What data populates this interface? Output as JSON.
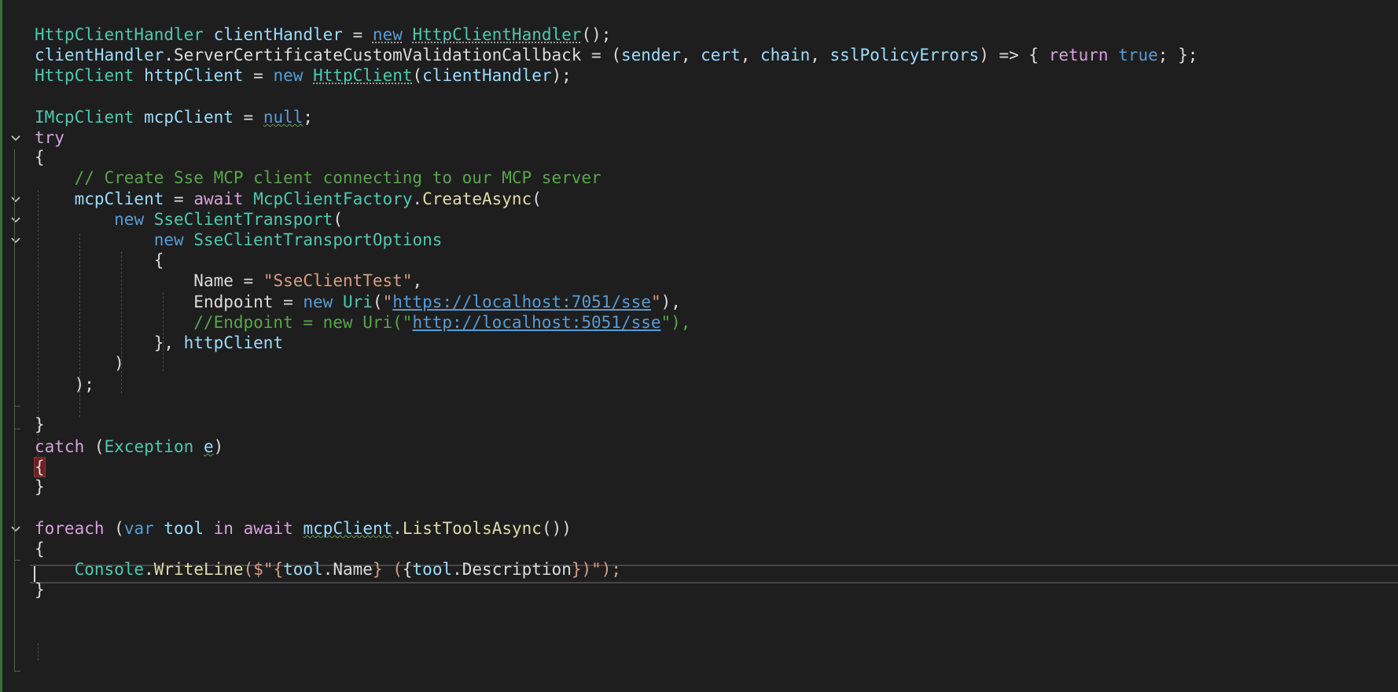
{
  "editor": {
    "lines": [
      {
        "tokens": [
          {
            "text": "HttpClientHandler",
            "c": "t"
          },
          {
            "text": " ",
            "c": "p"
          },
          {
            "text": "clientHandler",
            "c": "v"
          },
          {
            "text": " = ",
            "c": "p"
          },
          {
            "text": "new",
            "c": "k",
            "d": "dot"
          },
          {
            "text": " ",
            "c": "p"
          },
          {
            "text": "HttpClientHandler",
            "c": "t",
            "d": "dot"
          },
          {
            "text": "();",
            "c": "p"
          }
        ]
      },
      {
        "tokens": [
          {
            "text": "clientHandler",
            "c": "v"
          },
          {
            "text": ".",
            "c": "p"
          },
          {
            "text": "ServerCertificateCustomValidationCallback",
            "c": "p"
          },
          {
            "text": " = (",
            "c": "p"
          },
          {
            "text": "sender",
            "c": "v"
          },
          {
            "text": ", ",
            "c": "p"
          },
          {
            "text": "cert",
            "c": "v"
          },
          {
            "text": ", ",
            "c": "p"
          },
          {
            "text": "chain",
            "c": "v"
          },
          {
            "text": ", ",
            "c": "p"
          },
          {
            "text": "sslPolicyErrors",
            "c": "v"
          },
          {
            "text": ") => { ",
            "c": "p"
          },
          {
            "text": "return",
            "c": "kc"
          },
          {
            "text": " ",
            "c": "p"
          },
          {
            "text": "true",
            "c": "k"
          },
          {
            "text": "; };",
            "c": "p"
          }
        ]
      },
      {
        "tokens": [
          {
            "text": "HttpClient",
            "c": "t"
          },
          {
            "text": " ",
            "c": "p"
          },
          {
            "text": "httpClient",
            "c": "v"
          },
          {
            "text": " = ",
            "c": "p"
          },
          {
            "text": "new",
            "c": "k"
          },
          {
            "text": " ",
            "c": "p"
          },
          {
            "text": "HttpClient",
            "c": "t",
            "d": "dot"
          },
          {
            "text": "(",
            "c": "p"
          },
          {
            "text": "clientHandler",
            "c": "v"
          },
          {
            "text": ");",
            "c": "p"
          }
        ]
      },
      {
        "tokens": []
      },
      {
        "tokens": [
          {
            "text": "IMcpClient",
            "c": "t"
          },
          {
            "text": " ",
            "c": "p"
          },
          {
            "text": "mcpClient",
            "c": "v"
          },
          {
            "text": " = ",
            "c": "p"
          },
          {
            "text": "null",
            "c": "k",
            "d": "sq"
          },
          {
            "text": ";",
            "c": "p"
          }
        ]
      },
      {
        "tokens": [
          {
            "text": "try",
            "c": "kc"
          }
        ]
      },
      {
        "tokens": [
          {
            "text": "{",
            "c": "p"
          }
        ]
      },
      {
        "tokens": [
          {
            "text": "    // Create Sse MCP client connecting to our MCP server",
            "c": "cm"
          }
        ]
      },
      {
        "tokens": [
          {
            "text": "    ",
            "c": "p"
          },
          {
            "text": "mcpClient",
            "c": "v"
          },
          {
            "text": " = ",
            "c": "p"
          },
          {
            "text": "await",
            "c": "kc"
          },
          {
            "text": " ",
            "c": "p"
          },
          {
            "text": "McpClientFactory",
            "c": "t"
          },
          {
            "text": ".",
            "c": "p"
          },
          {
            "text": "CreateAsync",
            "c": "m"
          },
          {
            "text": "(",
            "c": "p"
          }
        ]
      },
      {
        "tokens": [
          {
            "text": "        ",
            "c": "p"
          },
          {
            "text": "new",
            "c": "k"
          },
          {
            "text": " ",
            "c": "p"
          },
          {
            "text": "SseClientTransport",
            "c": "t"
          },
          {
            "text": "(",
            "c": "p"
          }
        ]
      },
      {
        "tokens": [
          {
            "text": "            ",
            "c": "p"
          },
          {
            "text": "new",
            "c": "k"
          },
          {
            "text": " ",
            "c": "p"
          },
          {
            "text": "SseClientTransportOptions",
            "c": "t"
          }
        ]
      },
      {
        "tokens": [
          {
            "text": "            {",
            "c": "p"
          }
        ]
      },
      {
        "tokens": [
          {
            "text": "                ",
            "c": "p"
          },
          {
            "text": "Name",
            "c": "p"
          },
          {
            "text": " = ",
            "c": "p"
          },
          {
            "text": "\"SseClientTest\"",
            "c": "s"
          },
          {
            "text": ",",
            "c": "p"
          }
        ]
      },
      {
        "tokens": [
          {
            "text": "                ",
            "c": "p"
          },
          {
            "text": "Endpoint",
            "c": "p"
          },
          {
            "text": " = ",
            "c": "p"
          },
          {
            "text": "new",
            "c": "k"
          },
          {
            "text": " ",
            "c": "p"
          },
          {
            "text": "Uri",
            "c": "t"
          },
          {
            "text": "(",
            "c": "p"
          },
          {
            "text": "\"",
            "c": "s"
          },
          {
            "text": "https://localhost:7051/sse",
            "c": "u"
          },
          {
            "text": "\"",
            "c": "s"
          },
          {
            "text": "),",
            "c": "p"
          }
        ]
      },
      {
        "tokens": [
          {
            "text": "                //Endpoint = new Uri(\"",
            "c": "cm"
          },
          {
            "text": "http://localhost:5051/sse",
            "c": "cm-url"
          },
          {
            "text": "\"),",
            "c": "cm"
          }
        ]
      },
      {
        "tokens": [
          {
            "text": "            }, ",
            "c": "p"
          },
          {
            "text": "httpClient",
            "c": "v"
          }
        ]
      },
      {
        "tokens": [
          {
            "text": "        )",
            "c": "p"
          }
        ]
      },
      {
        "tokens": [
          {
            "text": "    );",
            "c": "p"
          }
        ]
      },
      {
        "tokens": []
      },
      {
        "tokens": [
          {
            "text": "}",
            "c": "p"
          }
        ]
      },
      {
        "tokens": [
          {
            "text": "catch",
            "c": "kc"
          },
          {
            "text": " (",
            "c": "p"
          },
          {
            "text": "Exception",
            "c": "t"
          },
          {
            "text": " ",
            "c": "p"
          },
          {
            "text": "e",
            "c": "v",
            "d": "sq"
          },
          {
            "text": ")",
            "c": "p"
          }
        ]
      },
      {
        "tokens": [
          {
            "text": "{",
            "c": "p",
            "d": "brace-hl"
          }
        ]
      },
      {
        "tokens": [
          {
            "text": "}",
            "c": "p"
          }
        ]
      },
      {
        "tokens": []
      },
      {
        "tokens": [
          {
            "text": "foreach",
            "c": "kc"
          },
          {
            "text": " (",
            "c": "p"
          },
          {
            "text": "var",
            "c": "k"
          },
          {
            "text": " ",
            "c": "p"
          },
          {
            "text": "tool",
            "c": "v"
          },
          {
            "text": " ",
            "c": "p"
          },
          {
            "text": "in",
            "c": "kc"
          },
          {
            "text": " ",
            "c": "p"
          },
          {
            "text": "await",
            "c": "kc"
          },
          {
            "text": " ",
            "c": "p"
          },
          {
            "text": "mcpClient",
            "c": "v",
            "d": "sq"
          },
          {
            "text": ".",
            "c": "p"
          },
          {
            "text": "ListToolsAsync",
            "c": "m"
          },
          {
            "text": "())",
            "c": "p"
          }
        ]
      },
      {
        "tokens": [
          {
            "text": "{",
            "c": "p"
          }
        ]
      },
      {
        "tokens": [
          {
            "text": "    ",
            "c": "p"
          },
          {
            "text": "Console",
            "c": "t"
          },
          {
            "text": ".",
            "c": "p"
          },
          {
            "text": "WriteLine",
            "c": "m"
          },
          {
            "text": "($\"{",
            "c": "s"
          },
          {
            "text": "tool",
            "c": "v"
          },
          {
            "text": ".",
            "c": "p"
          },
          {
            "text": "Name",
            "c": "p"
          },
          {
            "text": "} (",
            "c": "s"
          },
          {
            "text": "{",
            "c": "p"
          },
          {
            "text": "tool",
            "c": "v"
          },
          {
            "text": ".",
            "c": "p"
          },
          {
            "text": "Description",
            "c": "p"
          },
          {
            "text": "})\");",
            "c": "s"
          }
        ]
      },
      {
        "tokens": [
          {
            "text": "}",
            "c": "p"
          }
        ]
      }
    ],
    "fold_markers": [
      5,
      8,
      9,
      10,
      24
    ],
    "colors": {
      "background": "#1e1e1e",
      "keyword": "#569cd6",
      "control_keyword": "#d8a0df",
      "type": "#4ec9b0",
      "variable": "#9cdcfe",
      "method": "#dcdcaa",
      "string": "#d69d85",
      "comment": "#57a64a",
      "text": "#dcdcdc"
    },
    "icons": {
      "fold": "chevron-down-icon"
    }
  }
}
